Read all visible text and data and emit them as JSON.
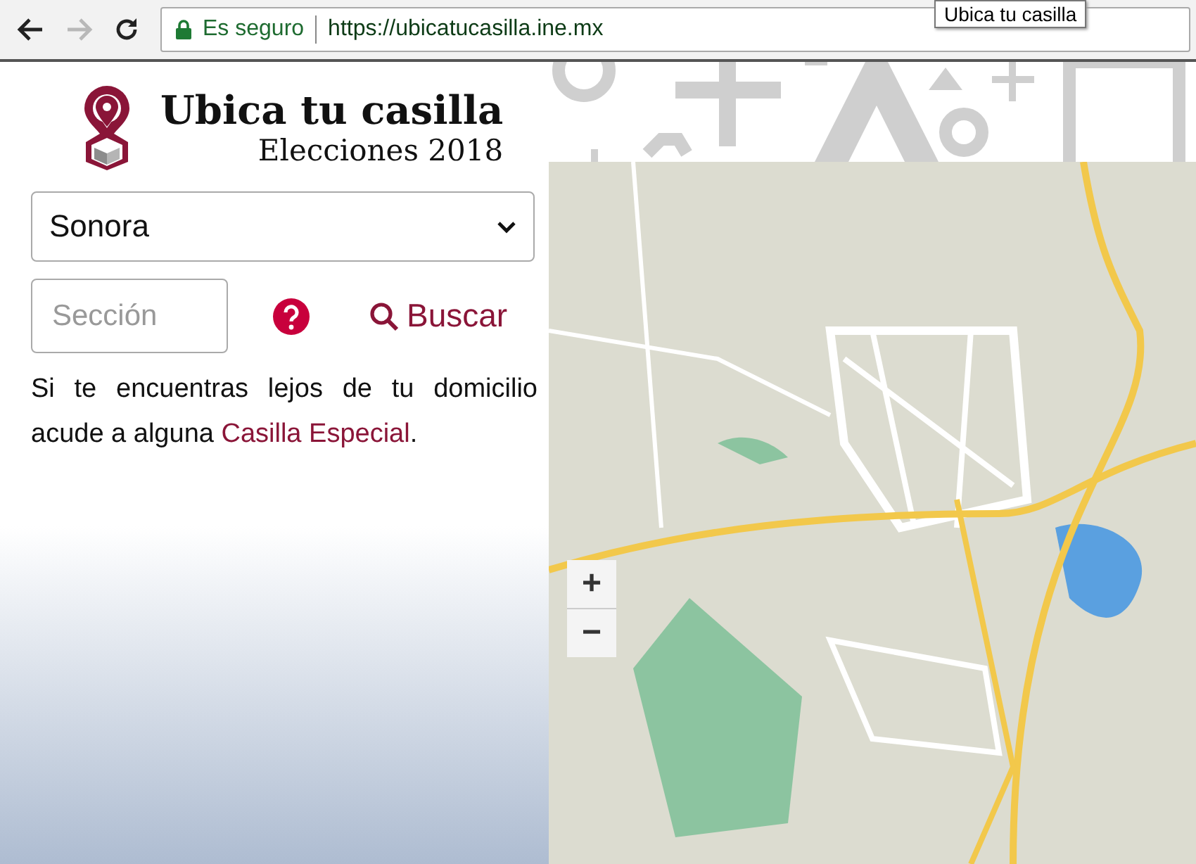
{
  "browser": {
    "nav": [
      {
        "kind": "back",
        "disabled": false
      },
      {
        "kind": "forward",
        "disabled": true
      },
      {
        "kind": "reload",
        "disabled": false
      }
    ],
    "security": "Es seguro",
    "url": "https://ubicatucasilla.ine.mx",
    "tooltip": "Ubica tu casilla"
  },
  "header": {
    "title": "Ubica tu casilla",
    "subtitle": "Elecciones 2018"
  },
  "state_select": {
    "value": "Sonora"
  },
  "section_field": {
    "placeholder": "Sección"
  },
  "search_button": {
    "label": "Buscar"
  },
  "notice": {
    "text": "Si te encuentras lejos de tu domicilio acude a alguna",
    "link": "Casilla Especial",
    "after": "."
  },
  "map": {
    "zoom_in": "+",
    "zoom_out": "−"
  }
}
